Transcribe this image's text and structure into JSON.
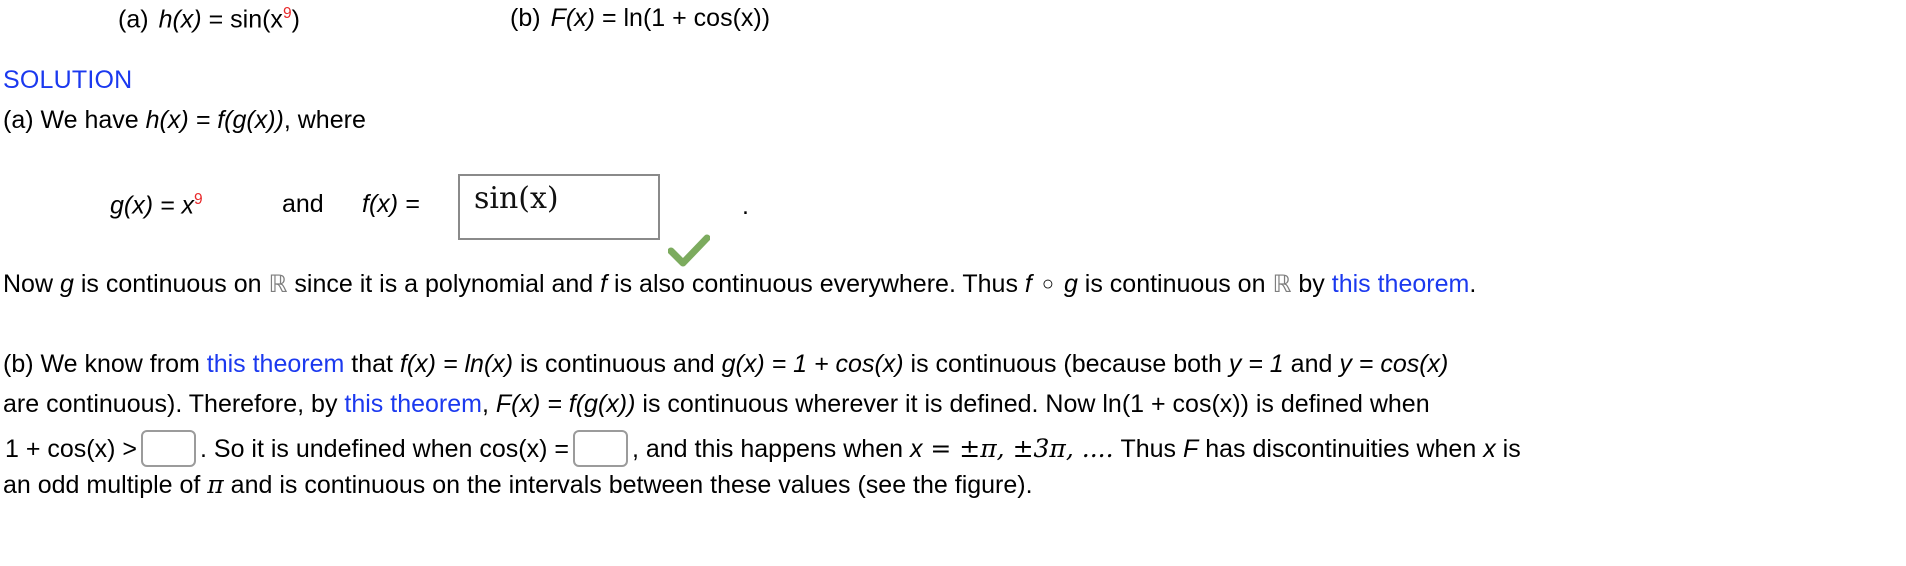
{
  "problem": {
    "part_a_label": "(a)",
    "part_a_expr_lhs": "h(x)",
    "part_a_eq": "=",
    "part_a_fn": "sin(x",
    "part_a_exponent": "9",
    "part_a_close": ")",
    "part_b_label": "(b)",
    "part_b_expr_lhs": "F(x)",
    "part_b_eq": "=",
    "part_b_rhs": "ln(1 + cos(x))"
  },
  "solution": {
    "heading": "SOLUTION",
    "heading_color": "#1b39ef",
    "part_a": {
      "intro_prefix": "(a) We have ",
      "intro_expr": "h(x) = f(g(x))",
      "intro_suffix": ", where",
      "g_def_lhs": "g(x) = x",
      "g_def_exponent": "9",
      "and_word": "and",
      "f_def_lhs": "f(x) =",
      "answer_value": "sin(x)",
      "answer_sin": "sin",
      "answer_open_paren": "(",
      "answer_var": "x",
      "answer_close_paren": ")",
      "answer_status": "correct",
      "trailing_period": ".",
      "conclusion": {
        "seg1": "Now ",
        "var_g": "g",
        "seg2": " is continuous on ",
        "reals_symbol": "ℝ",
        "seg3": " since it is a polynomial and ",
        "var_f": "f",
        "seg4": " is also continuous everywhere. Thus ",
        "composition_f": "f",
        "composition_op": "○",
        "composition_g": "g",
        "seg5": " is continuous on ",
        "reals_symbol_2": "ℝ",
        "seg6": " by ",
        "link_text": "this theorem",
        "seg7": "."
      }
    },
    "part_b": {
      "line1_seg1": "(b) We know from ",
      "line1_link": "this theorem",
      "line1_seg2": " that  ",
      "line1_expr1": "f(x) = ln(x)",
      "line1_seg3": "  is continuous and  ",
      "line1_expr2": "g(x) = 1 + cos(x)",
      "line1_seg4": "  is continuous (because both  ",
      "line1_expr3": "y = 1",
      "line1_seg5": "  and  ",
      "line1_expr4": "y = cos(x)",
      "line2_seg1": "are continuous). Therefore, by ",
      "line2_link": "this theorem",
      "line2_seg2": ",  ",
      "line2_expr1": "F(x) = f(g(x))",
      "line2_seg3": "  is continuous wherever it is defined. Now  ",
      "line2_expr2": "ln(1 + cos(x))",
      "line2_seg4": "  is defined when",
      "line3_expr1": "1 + cos(x) >",
      "line3_input1_value": "",
      "line3_seg1": ".  So it is undefined when  ",
      "line3_expr2": "cos(x) =",
      "line3_input2_value": "",
      "line3_seg2": ",  and this happens when  ",
      "line3_expr3_x": "x",
      "line3_expr3_rest": " = ±π, ±3π, ....",
      "line3_seg3": "  Thus ",
      "line3_var_F": "F",
      "line3_seg4": " has discontinuities when ",
      "line3_var_x": "x",
      "line3_seg5": " is",
      "line4_seg1": "an odd multiple of ",
      "line4_pi": "π",
      "line4_seg2": " and is continuous on the intervals between these values (see the figure)."
    }
  },
  "colors": {
    "link": "#1b39ef",
    "exponent_red": "#e8282a",
    "check_green": "#7cab5e",
    "box_border": "#8a8a8a",
    "input_border": "#9b9b9b",
    "reals_gray": "#7e7e7e"
  }
}
